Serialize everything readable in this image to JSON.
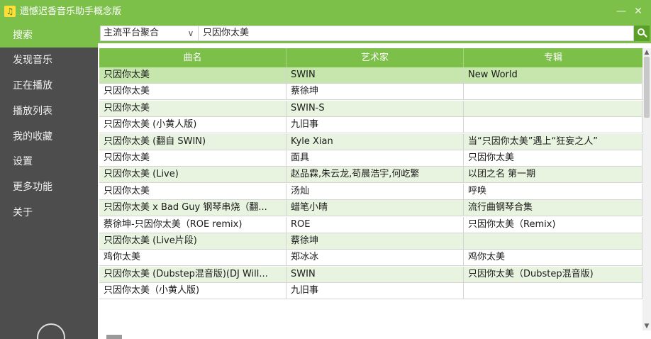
{
  "window": {
    "title": "遗憾迟香音乐助手概念版",
    "minimize": "—",
    "close": "✕"
  },
  "sidebar": {
    "items": [
      {
        "label": "搜索",
        "active": true
      },
      {
        "label": "发现音乐"
      },
      {
        "label": "正在播放"
      },
      {
        "label": "播放列表"
      },
      {
        "label": "我的收藏"
      },
      {
        "label": "设置"
      },
      {
        "label": "更多功能"
      },
      {
        "label": "关于"
      }
    ]
  },
  "search": {
    "platform": "主流平台聚合",
    "query": "只因你太美"
  },
  "table": {
    "headers": [
      "曲名",
      "艺术家",
      "专辑"
    ],
    "rows": [
      [
        "只因你太美",
        "SWIN",
        "New World"
      ],
      [
        "只因你太美",
        "蔡徐坤",
        ""
      ],
      [
        "只因你太美",
        "SWIN-S",
        ""
      ],
      [
        "只因你太美 (小黄人版)",
        "九旧事",
        ""
      ],
      [
        "只因你太美 (翻自 SWIN)",
        "Kyle Xian",
        "当“只因你太美”遇上“狂妄之人”"
      ],
      [
        "只因你太美",
        "面具",
        "只因你太美"
      ],
      [
        "只因你太美 (Live)",
        "赵品霖,朱云龙,苟晨浩宇,何屹繁",
        "以团之名 第一期"
      ],
      [
        "只因你太美",
        "汤灿",
        "呼唤"
      ],
      [
        "只因你太美 x Bad Guy 钢琴串烧（翻...",
        "蜡笔小晴",
        "流行曲钢琴合集"
      ],
      [
        "蔡徐坤-只因你太美（ROE remix)",
        "ROE",
        "只因你太美（Remix)"
      ],
      [
        "只因你太美 (Live片段)",
        "蔡徐坤",
        ""
      ],
      [
        "鸡你太美",
        "郑冰冰",
        "鸡你太美"
      ],
      [
        "只因你太美 (Dubstep混音版)(DJ Will...",
        "SWIN",
        "只因你太美（Dubstep混音版)"
      ],
      [
        "只因你太美（小黄人版)",
        "九旧事",
        ""
      ]
    ],
    "selected_row": 0
  },
  "colors": {
    "accent": "#7cc04a",
    "sidebar": "#4d4d4d",
    "row_alt": "#e9f4e0",
    "row_selected": "#c6e6ad"
  }
}
